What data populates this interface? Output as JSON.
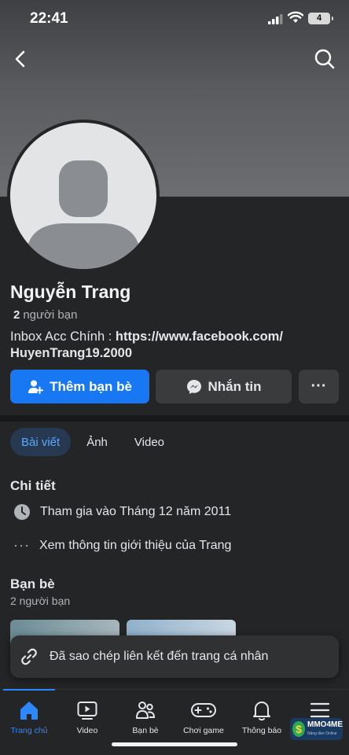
{
  "status_bar": {
    "time": "22:41",
    "battery": "4"
  },
  "profile": {
    "name": "Nguyễn Trang",
    "friend_count": "2",
    "friend_count_suffix": "người bạn",
    "bio_prefix": "Inbox Acc Chính : ",
    "bio_link": "https://www.facebook.com/ HuyenTrang19.2000"
  },
  "actions": {
    "add_friend": "Thêm bạn bè",
    "message": "Nhắn tin",
    "more": "···"
  },
  "tabs": [
    {
      "label": "Bài viết",
      "active": true
    },
    {
      "label": "Ảnh",
      "active": false
    },
    {
      "label": "Video",
      "active": false
    }
  ],
  "details": {
    "title": "Chi tiết",
    "joined": "Tham gia vào Tháng 12 năm 2011",
    "see_intro": "Xem thông tin giới thiệu của Trang"
  },
  "friends": {
    "title": "Bạn bè",
    "count_text": "2 người bạn"
  },
  "toast": {
    "text": "Đã sao chép liên kết đến trang cá nhân"
  },
  "bottom_nav": [
    {
      "label": "Trang chủ",
      "icon": "home-icon",
      "active": true
    },
    {
      "label": "Video",
      "icon": "video-icon",
      "active": false
    },
    {
      "label": "Bạn bè",
      "icon": "friends-icon",
      "active": false
    },
    {
      "label": "Chơi game",
      "icon": "gamepad-icon",
      "active": false
    },
    {
      "label": "Thông báo",
      "icon": "bell-icon",
      "active": false
    },
    {
      "label": "",
      "icon": "menu-icon",
      "active": false
    }
  ],
  "watermark": {
    "text": "MMO4ME",
    "sub": "Nâng tầm Online"
  },
  "colors": {
    "accent": "#1877f2",
    "active_tab_bg": "#263951",
    "background": "#242526"
  }
}
